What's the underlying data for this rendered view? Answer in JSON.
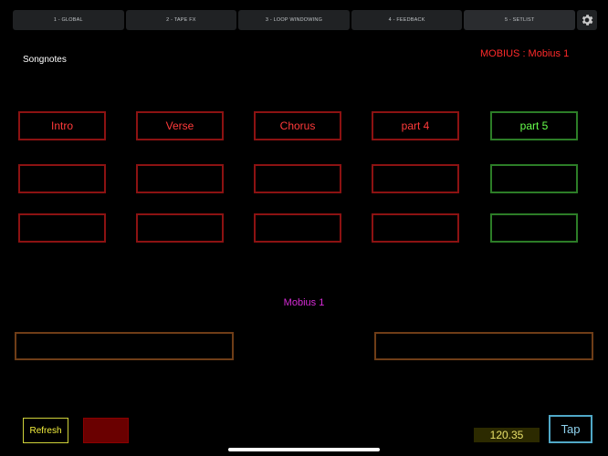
{
  "tabs": [
    {
      "label": "1 - GLOBAL"
    },
    {
      "label": "2 - TAPE FX"
    },
    {
      "label": "3 - LOOP WINDOWING"
    },
    {
      "label": "4 - FEEDBACK"
    },
    {
      "label": "5 - SETLIST"
    }
  ],
  "icons": {
    "settings": "gear-icon"
  },
  "page": {
    "title": "Songnotes",
    "status": "MOBIUS : Mobius 1"
  },
  "pads": {
    "row1": [
      "Intro",
      "Verse",
      "Chorus",
      "part 4",
      "part 5"
    ],
    "row2": [
      "",
      "",
      "",
      "",
      ""
    ],
    "row3": [
      "",
      "",
      "",
      "",
      ""
    ]
  },
  "middle_label": "Mobius 1",
  "footer": {
    "refresh_label": "Refresh",
    "bpm": "120.35",
    "tap_label": "Tap"
  },
  "colors": {
    "pad_red_border": "#8c1212",
    "pad_red_text": "#ff3a3a",
    "pad_green_border": "#2c7d27",
    "pad_green_text": "#67ff4c",
    "status_red": "#ff2a2a",
    "middle_magenta": "#d62bd6"
  }
}
